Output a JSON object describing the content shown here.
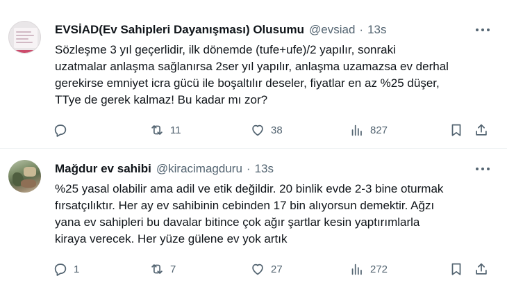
{
  "tweets": [
    {
      "author_name": "EVSİAD(Ev Sahipleri Dayanışması) Olusumu",
      "handle": "@evsiad",
      "separator": "·",
      "time": "13s",
      "avatar_icon": "document-logo-avatar",
      "text_lines": [
        "Sözleşme 3 yıl geçerlidir, ilk dönemde (tufe+ufe)/2 yapılır, sonraki",
        "uzatmalar anlaşma sağlanırsa 2ser yıl yapılır, anlaşma uzamazsa ev derhal",
        "gerekirse emniyet icra gücü ile boşaltılır deseler, fiyatlar en az %25 düşer,",
        "TTye de gerek kalmaz! Bu kadar mı zor?"
      ],
      "replies": "",
      "retweets": "11",
      "likes": "38",
      "views": "827"
    },
    {
      "author_name": "Mağdur ev sahibi",
      "handle": "@kiracimagduru",
      "separator": "·",
      "time": "13s",
      "avatar_icon": "photo-avatar",
      "text_lines": [
        "%25 yasal olabilir ama adil ve etik değildir. 20 binlik evde 2-3 bine oturmak",
        "fırsatçılıktır. Her ay ev sahibinin cebinden 17 bin alıyorsun demektir. Ağzı",
        "yana ev sahipleri bu davalar bitince çok ağır şartlar kesin yaptırımlarla",
        "kiraya verecek. Her yüze gülene ev yok artık"
      ],
      "replies": "1",
      "retweets": "7",
      "likes": "27",
      "views": "272"
    }
  ],
  "colors": {
    "text_primary": "#0f1419",
    "text_secondary": "#536471",
    "divider": "#eff3f4",
    "background": "#ffffff"
  },
  "icons": {
    "reply": "reply-icon",
    "retweet": "retweet-icon",
    "like": "heart-icon",
    "views": "views-chart-icon",
    "bookmark": "bookmark-icon",
    "share": "share-icon",
    "more": "more-dots-icon"
  }
}
